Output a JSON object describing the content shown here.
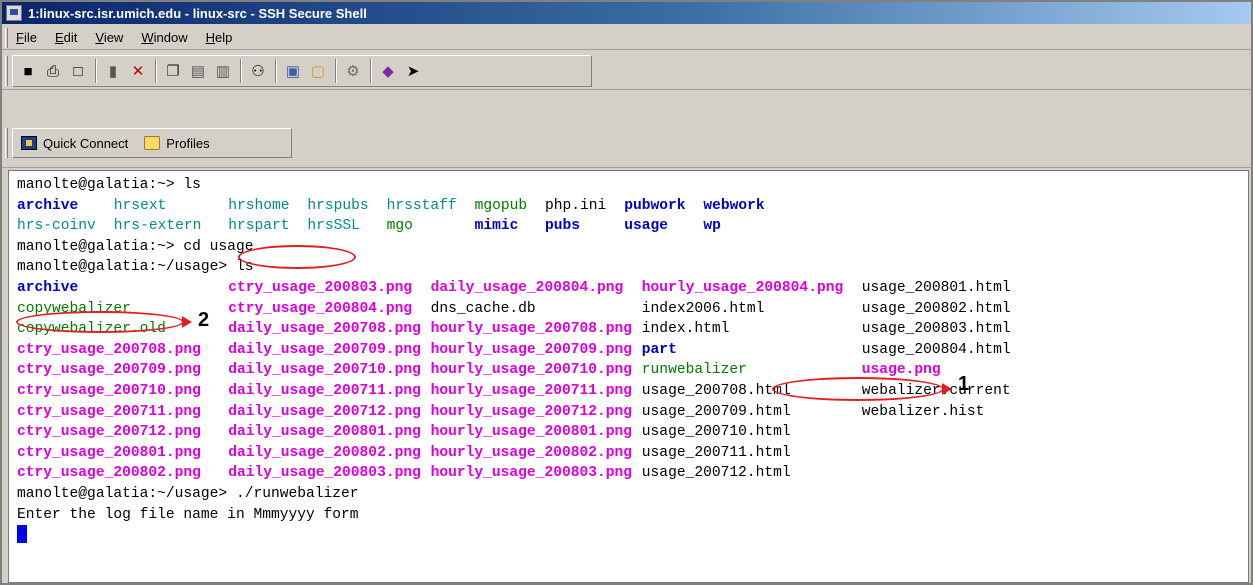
{
  "window": {
    "title": "1:linux-src.isr.umich.edu - linux-src - SSH Secure Shell"
  },
  "menu": [
    {
      "key": "F",
      "rest": "ile"
    },
    {
      "key": "E",
      "rest": "dit"
    },
    {
      "key": "V",
      "rest": "iew"
    },
    {
      "key": "W",
      "rest": "indow"
    },
    {
      "key": "H",
      "rest": "elp"
    }
  ],
  "toolbar": {
    "icons": [
      "save-icon",
      "print-icon",
      "print-preview-icon",
      "|",
      "disconnect-icon",
      "disconnect-all-icon",
      "|",
      "copy-icon",
      "paste-icon",
      "paste-alt-icon",
      "|",
      "find-icon",
      "|",
      "settings-icon",
      "profile-icon",
      "|",
      "key-icon",
      "|",
      "help-book-icon",
      "whats-this-icon"
    ]
  },
  "quickbar": {
    "quick_connect": "Quick Connect",
    "profiles": "Profiles"
  },
  "colors": {
    "dir": "#0000cc",
    "teal": "#008b8b",
    "image": "#dd00dd",
    "exec": "#007a00",
    "annotation": "#e02020",
    "cursor": "#0000ee"
  },
  "terminal": {
    "lines": [
      [
        {
          "t": "manolte@galatia:~> ls",
          "c": "black",
          "col": 0
        }
      ],
      [
        {
          "t": "archive",
          "c": "blue",
          "col": 0
        },
        {
          "t": "hrsext",
          "c": "teal",
          "col": 11
        },
        {
          "t": "hrshome",
          "c": "teal",
          "col": 24
        },
        {
          "t": "hrspubs",
          "c": "teal",
          "col": 33
        },
        {
          "t": "hrsstaff",
          "c": "teal",
          "col": 42
        },
        {
          "t": "mgopub",
          "c": "green",
          "col": 52
        },
        {
          "t": "php.ini",
          "c": "black",
          "col": 60
        },
        {
          "t": "pubwork",
          "c": "blue",
          "col": 69
        },
        {
          "t": "webwork",
          "c": "blue",
          "col": 78
        }
      ],
      [
        {
          "t": "hrs-coinv",
          "c": "teal",
          "col": 0
        },
        {
          "t": "hrs-extern",
          "c": "teal",
          "col": 11
        },
        {
          "t": "hrspart",
          "c": "teal",
          "col": 24
        },
        {
          "t": "hrsSSL",
          "c": "teal",
          "col": 33
        },
        {
          "t": "mgo",
          "c": "green",
          "col": 42
        },
        {
          "t": "mimic",
          "c": "blue",
          "col": 52
        },
        {
          "t": "pubs",
          "c": "blue",
          "col": 60
        },
        {
          "t": "usage",
          "c": "blue",
          "col": 69
        },
        {
          "t": "wp",
          "c": "blue",
          "col": 78
        }
      ],
      [
        {
          "t": "manolte@galatia:~> cd usage",
          "c": "black",
          "col": 0
        }
      ],
      [
        {
          "t": "manolte@galatia:~/usage> ls",
          "c": "black",
          "col": 0
        }
      ],
      [
        {
          "t": "archive",
          "c": "blue",
          "col": 0
        },
        {
          "t": "ctry_usage_200803.png",
          "c": "magenta",
          "col": 24
        },
        {
          "t": "daily_usage_200804.png",
          "c": "magenta",
          "col": 47
        },
        {
          "t": "hourly_usage_200804.png",
          "c": "magenta",
          "col": 71
        },
        {
          "t": "usage_200801.html",
          "c": "black",
          "col": 96
        }
      ],
      [
        {
          "t": "copywebalizer",
          "c": "green",
          "col": 0
        },
        {
          "t": "ctry_usage_200804.png",
          "c": "magenta",
          "col": 24
        },
        {
          "t": "dns_cache.db",
          "c": "black",
          "col": 47
        },
        {
          "t": "index2006.html",
          "c": "black",
          "col": 71
        },
        {
          "t": "usage_200802.html",
          "c": "black",
          "col": 96
        }
      ],
      [
        {
          "t": "copywebalizer.old",
          "c": "green",
          "col": 0
        },
        {
          "t": "daily_usage_200708.png",
          "c": "magenta",
          "col": 24
        },
        {
          "t": "hourly_usage_200708.png",
          "c": "magenta",
          "col": 47
        },
        {
          "t": "index.html",
          "c": "black",
          "col": 71
        },
        {
          "t": "usage_200803.html",
          "c": "black",
          "col": 96
        }
      ],
      [
        {
          "t": "ctry_usage_200708.png",
          "c": "magenta",
          "col": 0
        },
        {
          "t": "daily_usage_200709.png",
          "c": "magenta",
          "col": 24
        },
        {
          "t": "hourly_usage_200709.png",
          "c": "magenta",
          "col": 47
        },
        {
          "t": "part",
          "c": "blue",
          "col": 71
        },
        {
          "t": "usage_200804.html",
          "c": "black",
          "col": 96
        }
      ],
      [
        {
          "t": "ctry_usage_200709.png",
          "c": "magenta",
          "col": 0
        },
        {
          "t": "daily_usage_200710.png",
          "c": "magenta",
          "col": 24
        },
        {
          "t": "hourly_usage_200710.png",
          "c": "magenta",
          "col": 47
        },
        {
          "t": "runwebalizer",
          "c": "green",
          "col": 71
        },
        {
          "t": "usage.png",
          "c": "magenta",
          "col": 96
        }
      ],
      [
        {
          "t": "ctry_usage_200710.png",
          "c": "magenta",
          "col": 0
        },
        {
          "t": "daily_usage_200711.png",
          "c": "magenta",
          "col": 24
        },
        {
          "t": "hourly_usage_200711.png",
          "c": "magenta",
          "col": 47
        },
        {
          "t": "usage_200708.html",
          "c": "black",
          "col": 71
        },
        {
          "t": "webalizer.current",
          "c": "black",
          "col": 96
        }
      ],
      [
        {
          "t": "ctry_usage_200711.png",
          "c": "magenta",
          "col": 0
        },
        {
          "t": "daily_usage_200712.png",
          "c": "magenta",
          "col": 24
        },
        {
          "t": "hourly_usage_200712.png",
          "c": "magenta",
          "col": 47
        },
        {
          "t": "usage_200709.html",
          "c": "black",
          "col": 71
        },
        {
          "t": "webalizer.hist",
          "c": "black",
          "col": 96
        }
      ],
      [
        {
          "t": "ctry_usage_200712.png",
          "c": "magenta",
          "col": 0
        },
        {
          "t": "daily_usage_200801.png",
          "c": "magenta",
          "col": 24
        },
        {
          "t": "hourly_usage_200801.png",
          "c": "magenta",
          "col": 47
        },
        {
          "t": "usage_200710.html",
          "c": "black",
          "col": 71
        }
      ],
      [
        {
          "t": "ctry_usage_200801.png",
          "c": "magenta",
          "col": 0
        },
        {
          "t": "daily_usage_200802.png",
          "c": "magenta",
          "col": 24
        },
        {
          "t": "hourly_usage_200802.png",
          "c": "magenta",
          "col": 47
        },
        {
          "t": "usage_200711.html",
          "c": "black",
          "col": 71
        }
      ],
      [
        {
          "t": "ctry_usage_200802.png",
          "c": "magenta",
          "col": 0
        },
        {
          "t": "daily_usage_200803.png",
          "c": "magenta",
          "col": 24
        },
        {
          "t": "hourly_usage_200803.png",
          "c": "magenta",
          "col": 47
        },
        {
          "t": "usage_200712.html",
          "c": "black",
          "col": 71
        }
      ],
      [
        {
          "t": "manolte@galatia:~/usage> ./runwebalizer",
          "c": "black",
          "col": 0
        }
      ],
      [
        {
          "t": "Enter the log file name in Mmmyyyy form",
          "c": "black",
          "col": 0
        }
      ]
    ]
  },
  "annotations": [
    {
      "label": "1",
      "target": "runwebalizer"
    },
    {
      "label": "2",
      "target": "copywebalizer"
    }
  ]
}
